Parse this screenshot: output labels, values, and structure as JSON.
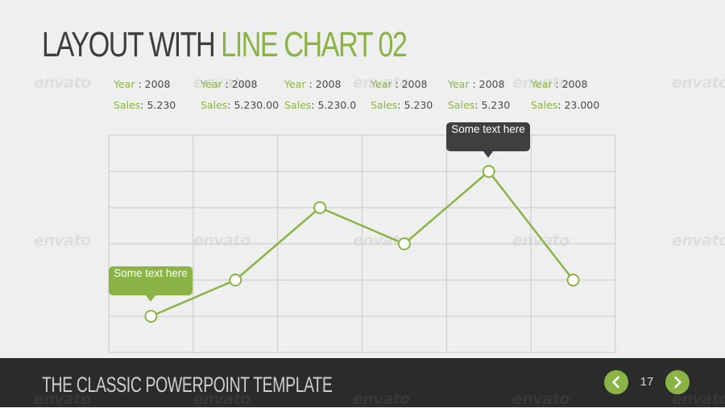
{
  "slide": {
    "title_part1": "LAYOUT WITH ",
    "title_part2": "LINE CHART 02"
  },
  "info_columns": [
    {
      "year_label": "Year",
      "year_value": " : 2008",
      "sales_label": "Sales",
      "sales_value": ": 5.230"
    },
    {
      "year_label": "Year",
      "year_value": " : 2008",
      "sales_label": "Sales",
      "sales_value": ": 5.230.00"
    },
    {
      "year_label": "Year",
      "year_value": " : 2008",
      "sales_label": "Sales",
      "sales_value": ": 5.230.0"
    },
    {
      "year_label": "Year",
      "year_value": " : 2008",
      "sales_label": "Sales",
      "sales_value": ": 5.230"
    },
    {
      "year_label": "Year",
      "year_value": " : 2008",
      "sales_label": "Sales",
      "sales_value": ": 5.230"
    },
    {
      "year_label": "Year",
      "year_value": " : 2008",
      "sales_label": "Sales",
      "sales_value": ": 23.000"
    }
  ],
  "chart_data": {
    "type": "line",
    "title": "",
    "xlabel": "",
    "ylabel": "",
    "x": [
      1,
      2,
      3,
      4,
      5,
      6
    ],
    "values": [
      1,
      2,
      4,
      3,
      5,
      2
    ],
    "ylim": [
      0,
      6
    ],
    "grid": true,
    "line_color": "#8bb446",
    "grid_color": "#c8c8c8"
  },
  "callouts": {
    "low_text": "Some text here",
    "high_text": "Some text here"
  },
  "footer": {
    "text": "THE CLASSIC POWERPOINT TEMPLATE",
    "page_number": "17",
    "prev_icon": "chevron-left-icon",
    "next_icon": "chevron-right-icon"
  },
  "watermark": {
    "text": "envato"
  },
  "colors": {
    "accent": "#8bb446",
    "dark": "#3e3e3e",
    "footer_bg": "#2b2b2b",
    "background": "#efefef"
  }
}
